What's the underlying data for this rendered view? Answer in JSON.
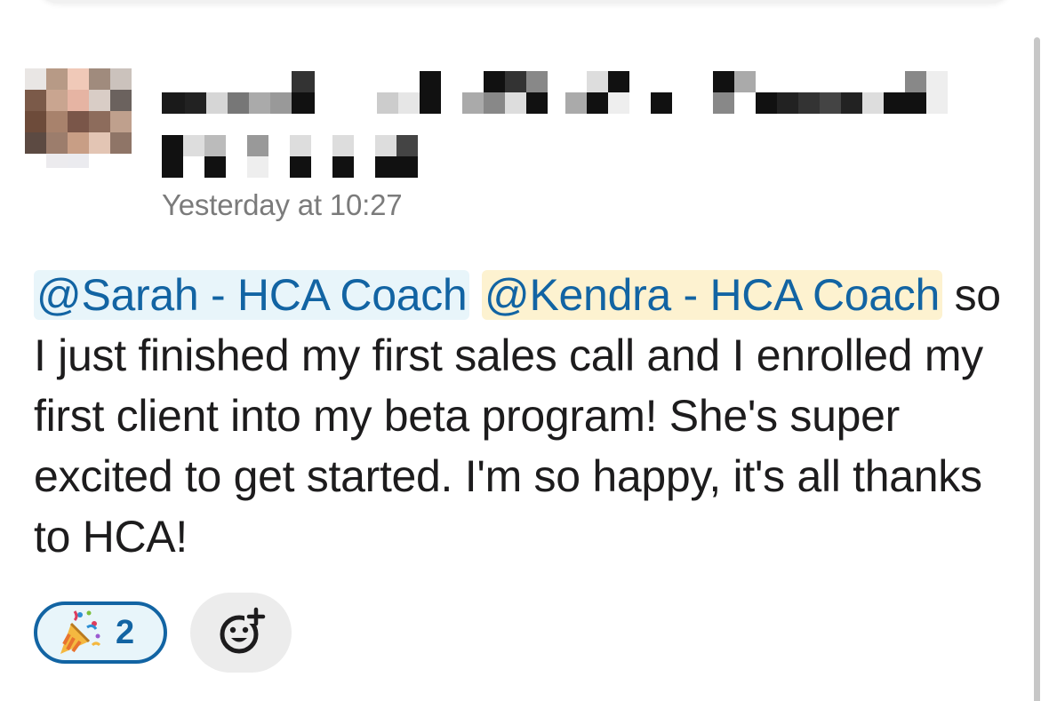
{
  "message": {
    "timestamp": "Yesterday at 10:27",
    "mention_1": "@Sarah - HCA Coach",
    "mention_2": "@Kendra - HCA Coach",
    "body_text": " so I just finished my first sales call and I enrolled my first client into my beta program! She's super excited to get started. I'm so happy, it's all thanks to HCA!"
  },
  "reactions": [
    {
      "emoji": "party-popper-icon",
      "count": "2",
      "selected": true
    }
  ],
  "add_reaction": {
    "icon": "add-reaction-icon"
  },
  "colors": {
    "mention_text": "#1264a3",
    "mention_self_bg": "#e8f5fa",
    "mention_other_bg": "#fdf2d0",
    "timestamp": "#7b7b7b",
    "reaction_border": "#1264a3"
  }
}
